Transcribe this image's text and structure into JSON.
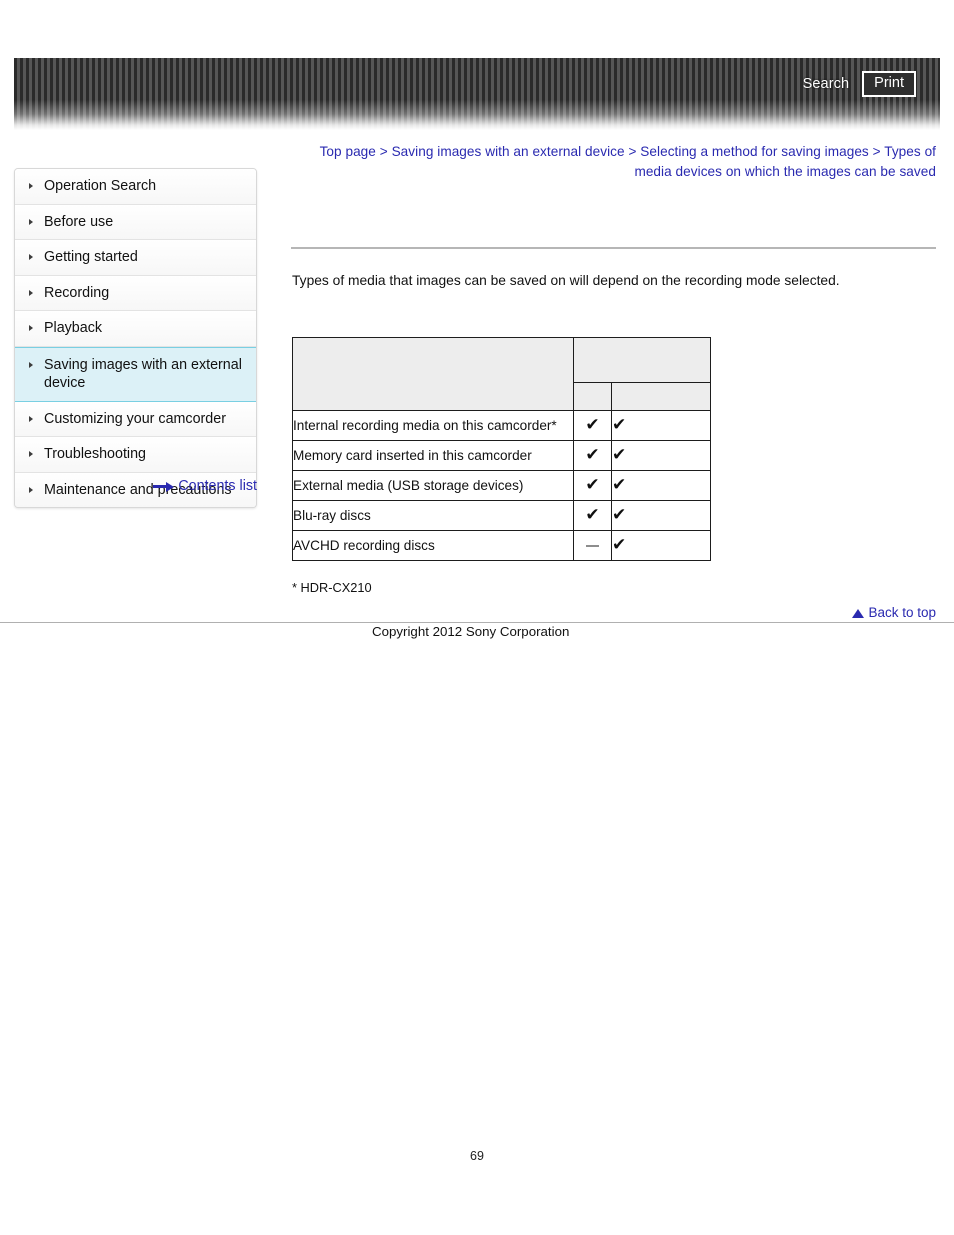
{
  "banner": {
    "search_label": "Search",
    "print_label": "Print"
  },
  "breadcrumb": {
    "items": [
      "Top page",
      "Saving images with an external device",
      "Selecting a method for saving images",
      "Types of media devices on which the images can be saved"
    ],
    "separator": ">"
  },
  "sidebar": {
    "items": [
      {
        "label": "Operation Search",
        "active": false
      },
      {
        "label": "Before use",
        "active": false
      },
      {
        "label": "Getting started",
        "active": false
      },
      {
        "label": "Recording",
        "active": false
      },
      {
        "label": "Playback",
        "active": false
      },
      {
        "label": "Saving images with an external device",
        "active": true
      },
      {
        "label": "Customizing your camcorder",
        "active": false
      },
      {
        "label": "Troubleshooting",
        "active": false
      },
      {
        "label": "Maintenance and precautions",
        "active": false
      }
    ],
    "contents_list_label": "Contents list"
  },
  "main": {
    "intro": "Types of media that images can be saved on will depend on the recording mode selected.",
    "footnote": "* HDR-CX210"
  },
  "table": {
    "headers": {
      "label_column": "",
      "group": "",
      "sub_a": "",
      "sub_b": ""
    },
    "check_glyph": "✔",
    "rows": [
      {
        "label": "Internal recording media on this camcorder*",
        "a": "check",
        "b": "check"
      },
      {
        "label": "Memory card inserted in this camcorder",
        "a": "check",
        "b": "check"
      },
      {
        "label": "External media (USB storage devices)",
        "a": "check",
        "b": "check"
      },
      {
        "label": "Blu-ray discs",
        "a": "check",
        "b": "check"
      },
      {
        "label": "AVCHD recording discs",
        "a": "dash",
        "b": "check"
      }
    ]
  },
  "footer": {
    "back_to_top_label": "Back to top",
    "copyright": "Copyright 2012 Sony Corporation",
    "page_number": "69"
  },
  "colors": {
    "link": "#2a2ab0",
    "active_sidebar_bg": "#dcf1f7",
    "active_sidebar_border": "#79cfe2",
    "table_header_bg": "#ededed"
  }
}
